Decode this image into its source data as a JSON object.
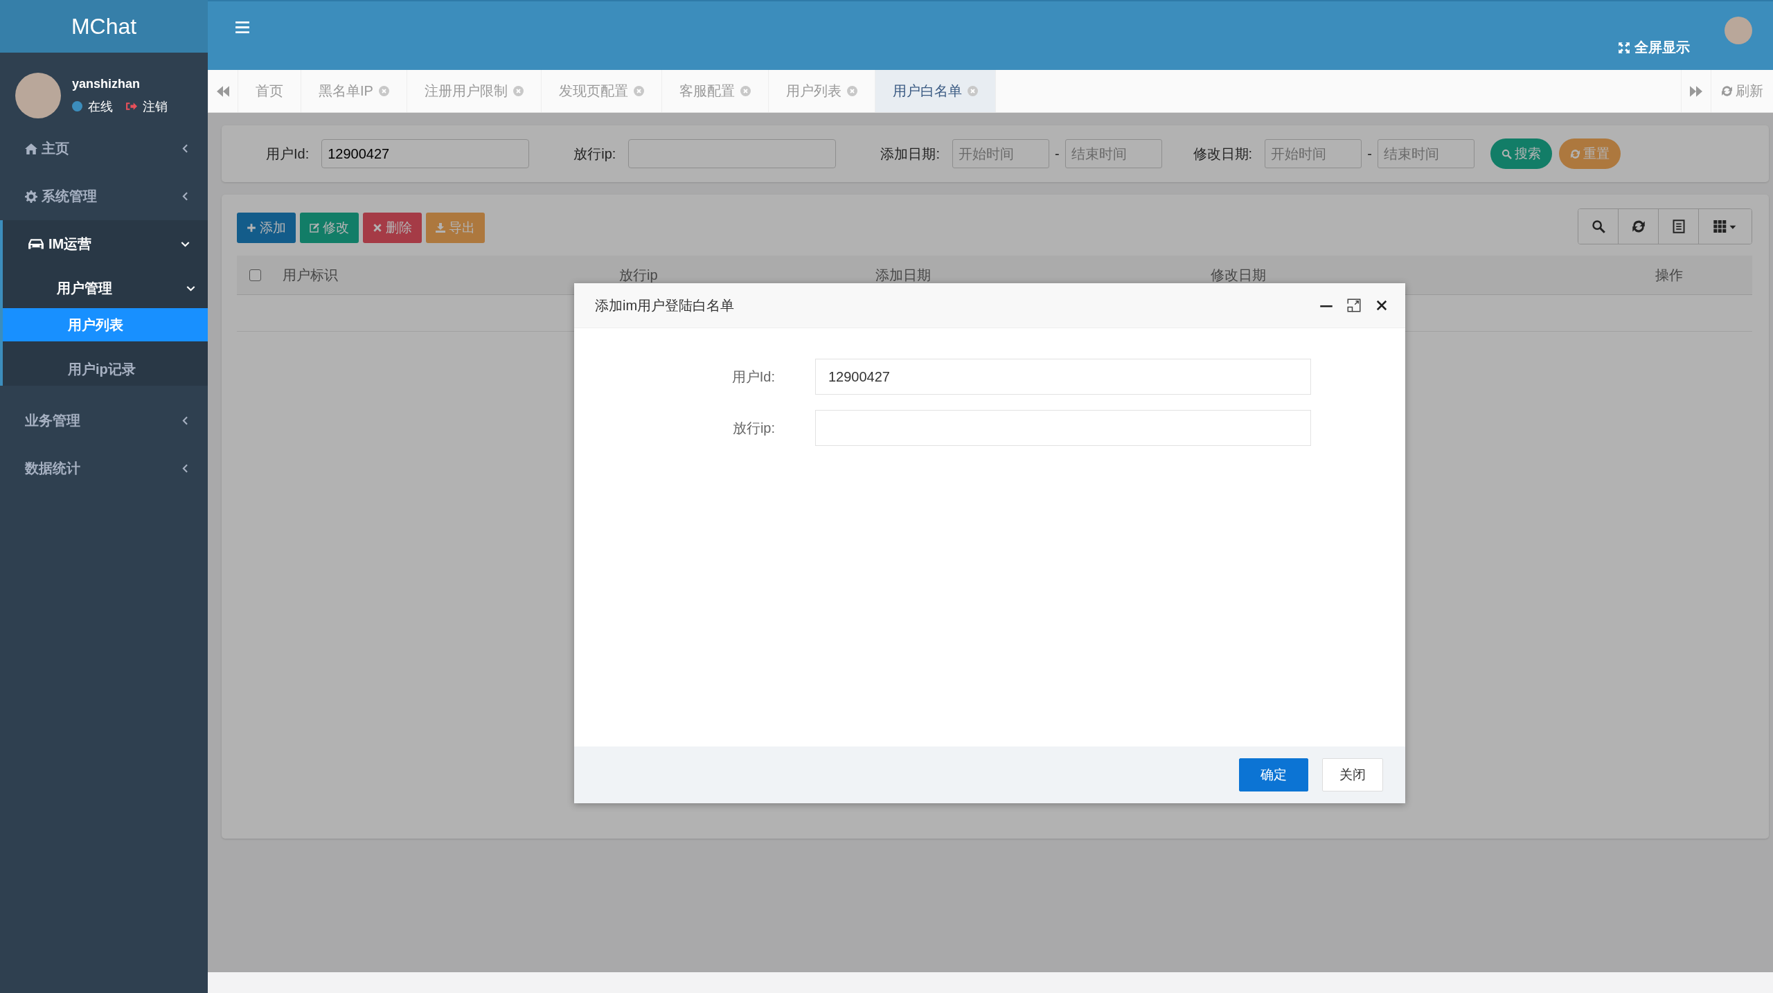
{
  "logo": "MChat",
  "user": {
    "name": "yanshizhan",
    "status": "在线",
    "logout": "注销"
  },
  "nav": [
    {
      "label": "主页",
      "expanded": false
    },
    {
      "label": "系统管理",
      "expanded": false
    },
    {
      "label": "IM运营",
      "expanded": true,
      "children": [
        {
          "label": "用户管理",
          "expanded": true,
          "children": [
            {
              "label": "用户列表",
              "selected": true
            },
            {
              "label": "用户ip记录",
              "selected": false
            }
          ]
        }
      ]
    },
    {
      "label": "业务管理",
      "expanded": false
    },
    {
      "label": "数据统计",
      "expanded": false
    }
  ],
  "header": {
    "fullscreen": "全屏显示"
  },
  "tabs": [
    {
      "label": "首页",
      "closable": false,
      "selected": false
    },
    {
      "label": "黑名单IP",
      "closable": true,
      "selected": false
    },
    {
      "label": "注册用户限制",
      "closable": true,
      "selected": false
    },
    {
      "label": "发现页配置",
      "closable": true,
      "selected": false
    },
    {
      "label": "客服配置",
      "closable": true,
      "selected": false
    },
    {
      "label": "用户列表",
      "closable": true,
      "selected": false
    },
    {
      "label": "用户白名单",
      "closable": true,
      "selected": true
    }
  ],
  "refresh": "刷新",
  "search": {
    "fields": [
      {
        "label": "用户Id:",
        "kind": "text",
        "value": "12900427"
      },
      {
        "label": "放行ip:",
        "kind": "text"
      },
      {
        "label": "添加日期:",
        "kind": "range",
        "from_placeholder": "开始时间",
        "to_placeholder": "结束时间",
        "separator": "-"
      },
      {
        "label": "修改日期:",
        "kind": "range",
        "from_placeholder": "开始时间",
        "to_placeholder": "结束时间",
        "separator": "-"
      }
    ],
    "buttons": [
      {
        "label": "搜索",
        "kind": "search"
      },
      {
        "label": "重置",
        "kind": "reset"
      }
    ]
  },
  "toolbar": [
    {
      "label": "添加",
      "kind": "add"
    },
    {
      "label": "修改",
      "kind": "edit"
    },
    {
      "label": "删除",
      "kind": "delete"
    },
    {
      "label": "导出",
      "kind": "export"
    }
  ],
  "table": {
    "select_all": {
      "checked": false
    },
    "columns": [
      "用户标识",
      "放行ip",
      "添加日期",
      "修改日期",
      "操作"
    ]
  },
  "dialog": {
    "title": "添加im用户登陆白名单",
    "fields": [
      {
        "label": "用户Id:",
        "value": "12900427"
      },
      {
        "label": "放行ip:"
      }
    ],
    "buttons": [
      {
        "label": "确定",
        "kind": "primary"
      },
      {
        "label": "关闭",
        "kind": "default"
      }
    ]
  }
}
